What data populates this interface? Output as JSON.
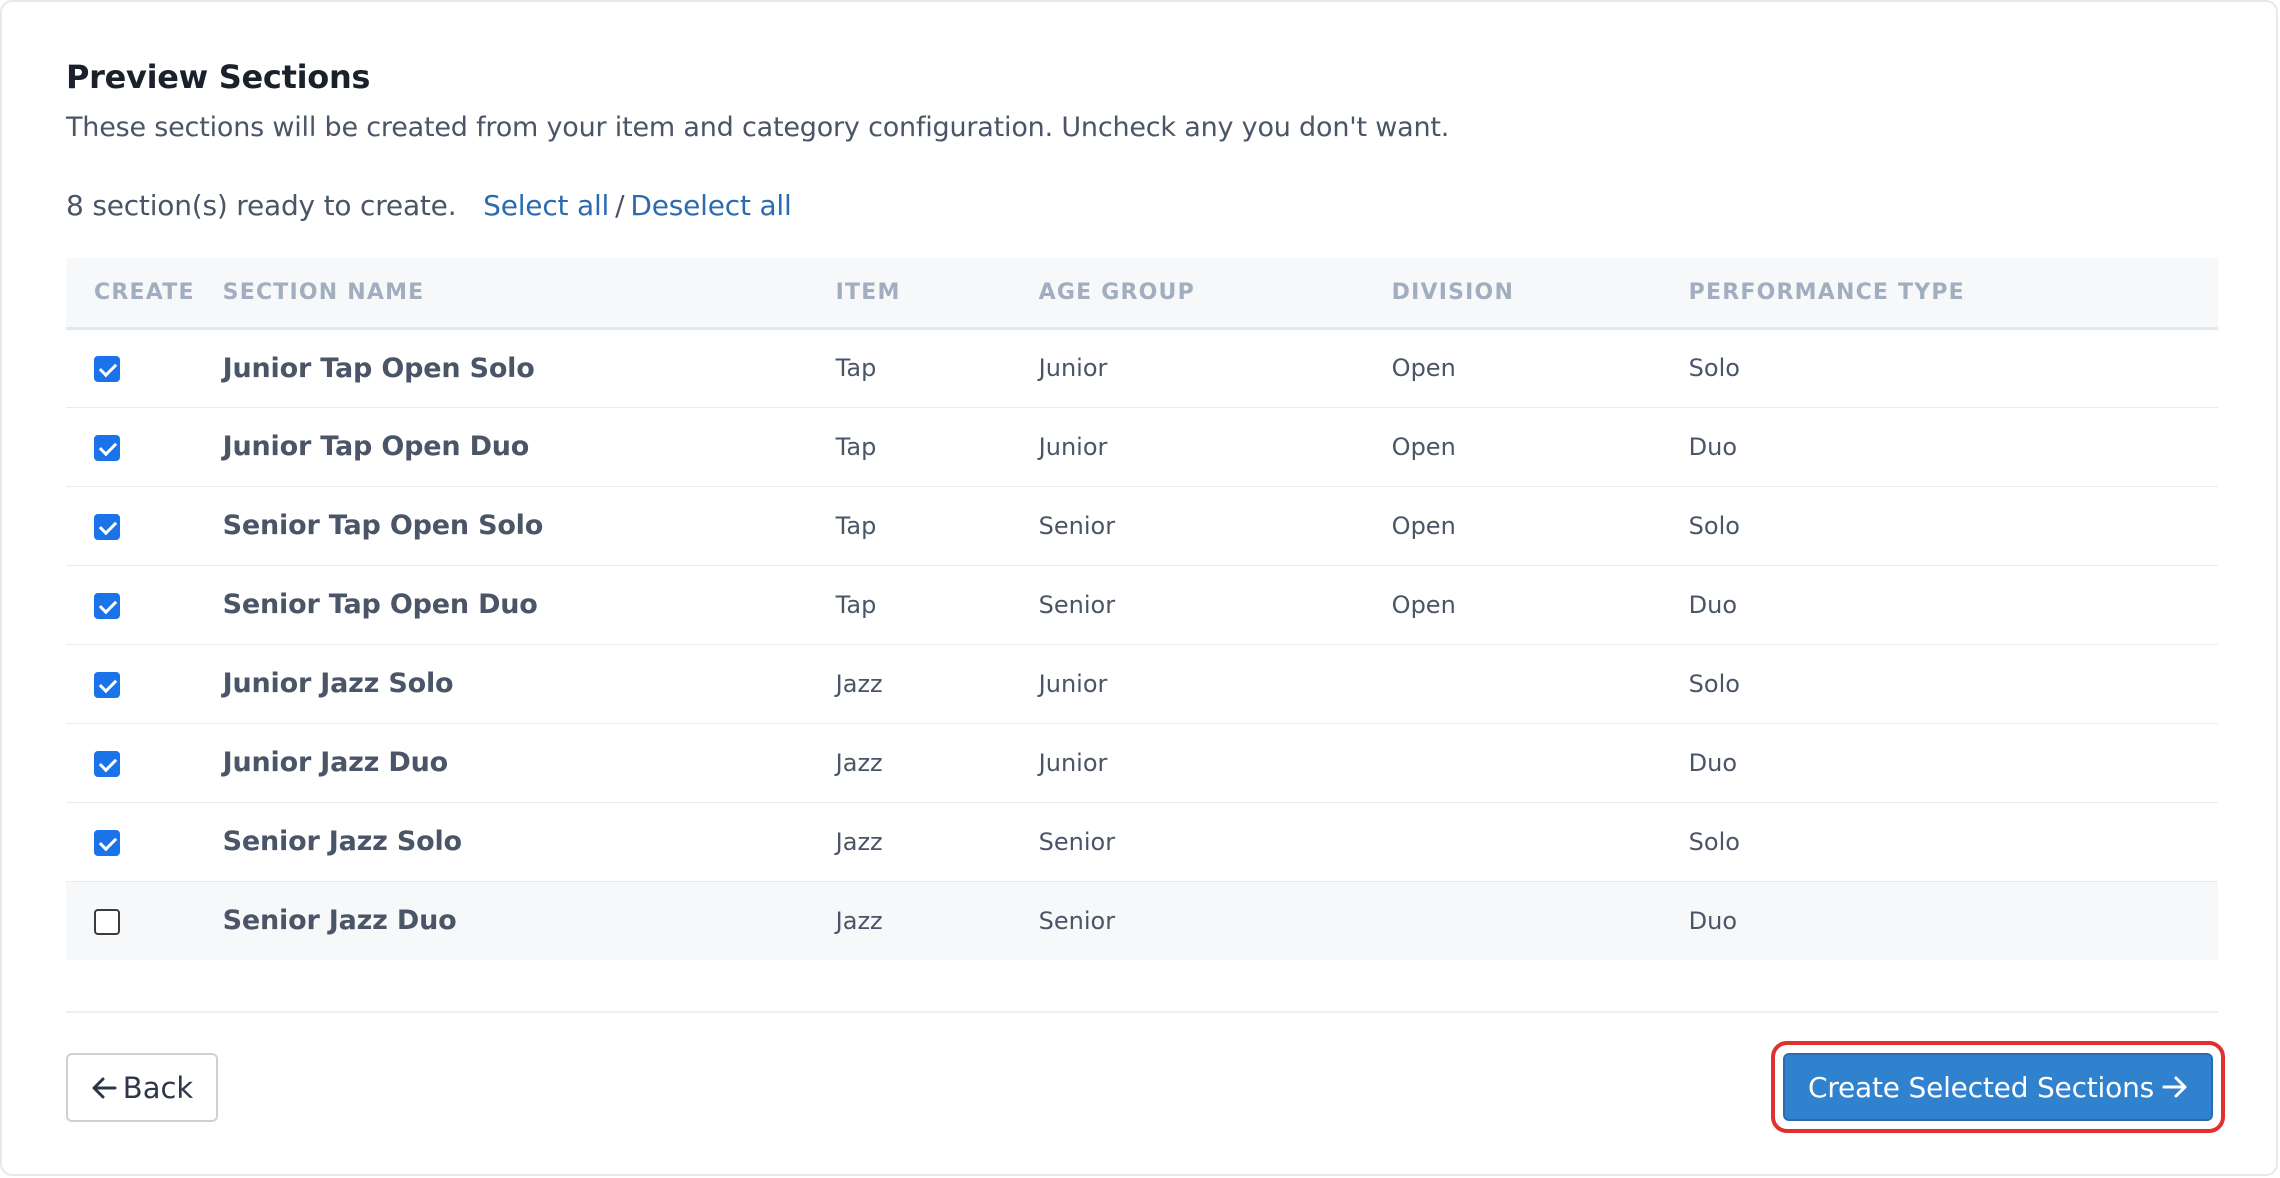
{
  "header": {
    "title": "Preview Sections",
    "subtitle": "These sections will be created from your item and category configuration. Uncheck any you don't want."
  },
  "summary": {
    "count_text": "8 section(s) ready to create.",
    "select_all": "Select all",
    "separator": "/",
    "deselect_all": "Deselect all"
  },
  "table": {
    "columns": [
      "CREATE",
      "SECTION NAME",
      "ITEM",
      "AGE GROUP",
      "DIVISION",
      "PERFORMANCE TYPE"
    ],
    "rows": [
      {
        "checked": true,
        "name": "Junior Tap Open Solo",
        "item": "Tap",
        "age_group": "Junior",
        "division": "Open",
        "performance_type": "Solo"
      },
      {
        "checked": true,
        "name": "Junior Tap Open Duo",
        "item": "Tap",
        "age_group": "Junior",
        "division": "Open",
        "performance_type": "Duo"
      },
      {
        "checked": true,
        "name": "Senior Tap Open Solo",
        "item": "Tap",
        "age_group": "Senior",
        "division": "Open",
        "performance_type": "Solo"
      },
      {
        "checked": true,
        "name": "Senior Tap Open Duo",
        "item": "Tap",
        "age_group": "Senior",
        "division": "Open",
        "performance_type": "Duo"
      },
      {
        "checked": true,
        "name": "Junior Jazz Solo",
        "item": "Jazz",
        "age_group": "Junior",
        "division": "",
        "performance_type": "Solo"
      },
      {
        "checked": true,
        "name": "Junior Jazz Duo",
        "item": "Jazz",
        "age_group": "Junior",
        "division": "",
        "performance_type": "Duo"
      },
      {
        "checked": true,
        "name": "Senior Jazz Solo",
        "item": "Jazz",
        "age_group": "Senior",
        "division": "",
        "performance_type": "Solo"
      },
      {
        "checked": false,
        "name": "Senior Jazz Duo",
        "item": "Jazz",
        "age_group": "Senior",
        "division": "",
        "performance_type": "Duo"
      }
    ]
  },
  "footer": {
    "back_label": "Back",
    "back_icon": "arrow-left-icon",
    "create_label": "Create Selected Sections",
    "create_icon": "arrow-right-icon"
  },
  "colors": {
    "accent": "#3182ce",
    "link": "#2b6cb0",
    "checkbox": "#1a73e8",
    "highlight": "#e03131"
  }
}
